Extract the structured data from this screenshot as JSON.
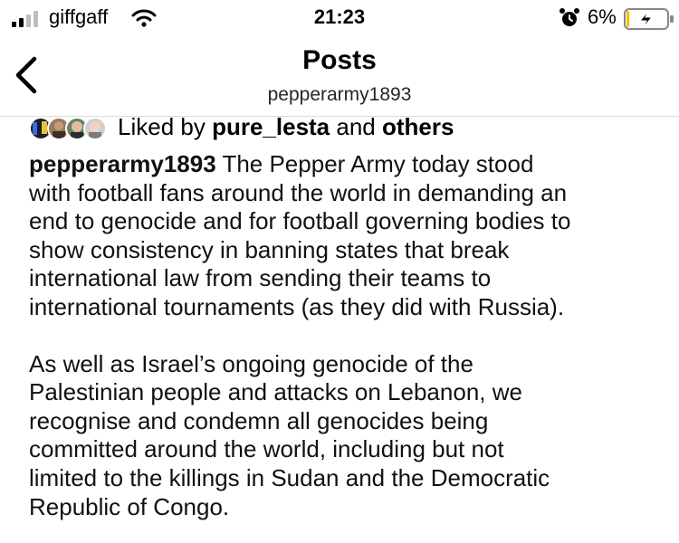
{
  "status_bar": {
    "carrier": "giffgaff",
    "time": "21:23",
    "battery_percent": "6%",
    "signal_icon": "signal-bars-icon",
    "wifi_icon": "wifi-icon",
    "alarm_icon": "alarm-clock-icon",
    "battery_icon": "battery-charging-icon",
    "battery_level": 0.06,
    "accent_color": "#f2c200"
  },
  "header": {
    "back_icon": "chevron-left-icon",
    "title": "Posts",
    "subtitle": "pepperarmy1893"
  },
  "likes": {
    "prefix": "Liked by ",
    "user": "pure_lesta",
    "middle": " and ",
    "others": "others"
  },
  "caption": {
    "username": "pepperarmy1893",
    "paragraph1": " The Pepper Army today stood\nwith football fans around the world in demanding an\nend to genocide and for football governing bodies to\nshow consistency in banning states that break\ninternational law from sending their teams to\ninternational tournaments (as they did with Russia).",
    "paragraph2": "As well as Israel’s ongoing genocide of the\nPalestinian people and attacks on Lebanon, we\nrecognise and condemn all genocides being\ncommitted around the world, including but not\nlimited to the killings in Sudan and the Democratic\nRepublic of Congo."
  }
}
